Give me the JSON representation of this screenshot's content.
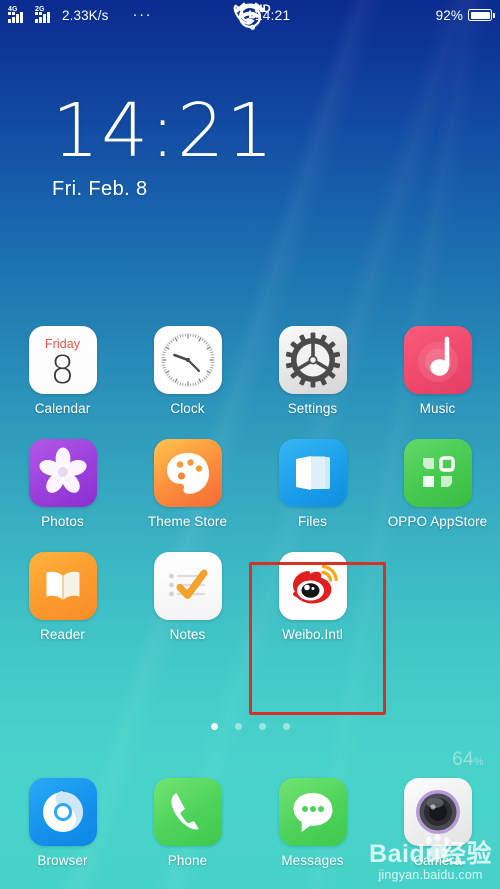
{
  "status_bar": {
    "signal_1_label": "4G",
    "signal_2_label": "2G",
    "network_speed": "2.33K/s",
    "wifi_icon": "wifi-icon",
    "more_icon": "ellipsis-icon",
    "time": "14:21",
    "alarm_icon": "alarm-clock-icon",
    "volte_icon": "hd-call-icon",
    "battery_percent": "92%",
    "battery_level": 92
  },
  "clock_widget": {
    "time": "14:21",
    "date": "Fri. Feb. 8"
  },
  "app_grid": {
    "rows": [
      [
        {
          "label": "Calendar",
          "icon": "calendar-icon",
          "cal_weekday": "Friday",
          "cal_day": "8"
        },
        {
          "label": "Clock",
          "icon": "clock-icon"
        },
        {
          "label": "Settings",
          "icon": "gear-icon"
        },
        {
          "label": "Music",
          "icon": "music-note-icon"
        }
      ],
      [
        {
          "label": "Photos",
          "icon": "flower-icon"
        },
        {
          "label": "Theme Store",
          "icon": "paint-palette-icon"
        },
        {
          "label": "Files",
          "icon": "folder-icon"
        },
        {
          "label": "OPPO AppStore",
          "icon": "appstore-grid-icon"
        }
      ],
      [
        {
          "label": "Reader",
          "icon": "open-book-icon"
        },
        {
          "label": "Notes",
          "icon": "checkmark-notes-icon"
        },
        {
          "label": "Weibo.Intl",
          "icon": "weibo-eye-icon"
        },
        {
          "label": "",
          "icon": ""
        }
      ]
    ]
  },
  "highlight": {
    "target_app": "Weibo.Intl",
    "color": "#d93025"
  },
  "page_dots": {
    "count": 4,
    "active_index": 0
  },
  "dock": {
    "items": [
      {
        "label": "Browser",
        "icon": "browser-swirl-icon"
      },
      {
        "label": "Phone",
        "icon": "phone-handset-icon"
      },
      {
        "label": "Messages",
        "icon": "speech-bubble-icon"
      },
      {
        "label": "Camera",
        "icon": "camera-lens-icon"
      }
    ]
  },
  "overlays": {
    "battery_ghost_value": "64",
    "battery_ghost_unit": "%",
    "watermark_main": "Baidu经验",
    "watermark_sub": "jingyan.baidu.com",
    "watermark_paw_icon": "paw-print-icon"
  },
  "colors": {
    "wallpaper_top": "#0a2b8f",
    "wallpaper_bottom": "#47d2c9",
    "highlight_red": "#d93025",
    "calendar_red": "#e8533f"
  }
}
